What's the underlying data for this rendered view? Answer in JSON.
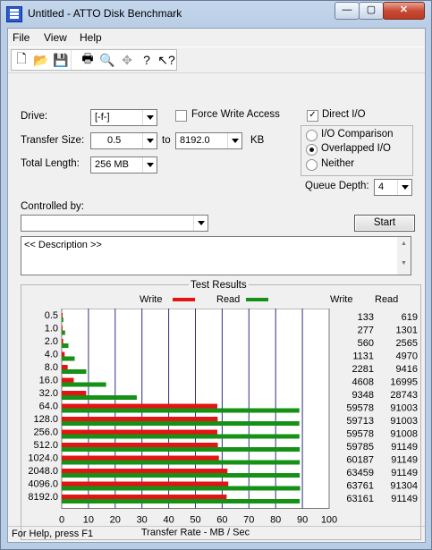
{
  "window": {
    "title": "Untitled - ATTO Disk Benchmark",
    "buttons": [
      "—",
      "▢",
      "✕"
    ]
  },
  "menu": [
    "File",
    "View",
    "Help"
  ],
  "toolbar": {
    "icons": [
      {
        "name": "new-document-icon",
        "glyph": "🗋"
      },
      {
        "name": "open-folder-icon",
        "glyph": "📂"
      },
      {
        "name": "save-icon",
        "glyph": "💾"
      },
      {
        "name": "print-icon",
        "glyph": "🖶"
      },
      {
        "name": "print-preview-icon",
        "glyph": "🔍"
      },
      {
        "name": "move-icon",
        "glyph": "✥"
      },
      {
        "name": "help-icon",
        "glyph": "?"
      },
      {
        "name": "context-help-icon",
        "glyph": "↖?"
      }
    ]
  },
  "form": {
    "drive_label": "Drive:",
    "drive_value": "[-f-]",
    "force_write_label": "Force Write Access",
    "direct_io_label": "Direct I/O",
    "transfer_size_label": "Transfer Size:",
    "transfer_from": "0.5",
    "to_label": "to",
    "transfer_to": "8192.0",
    "kb_label": "KB",
    "total_length_label": "Total Length:",
    "total_length": "256 MB",
    "io_comparison_label": "I/O Comparison",
    "overlapped_io_label": "Overlapped I/O",
    "neither_label": "Neither",
    "queue_depth_label": "Queue Depth:",
    "queue_depth_value": "4",
    "controlled_by_label": "Controlled by:",
    "controlled_by_value": "",
    "start_label": "Start",
    "description": "<< Description >>"
  },
  "results": {
    "title": "Test Results",
    "write_legend": "Write",
    "read_legend": "Read",
    "write_header": "Write",
    "read_header": "Read",
    "axis_title": "Transfer Rate - MB / Sec",
    "colors": {
      "write": "#e41414",
      "read": "#159116",
      "grid": "#2f2f83"
    }
  },
  "chart_data": {
    "type": "bar",
    "categories": [
      "0.5",
      "1.0",
      "2.0",
      "4.0",
      "8.0",
      "16.0",
      "32.0",
      "64.0",
      "128.0",
      "256.0",
      "512.0",
      "1024.0",
      "2048.0",
      "4096.0",
      "8192.0"
    ],
    "series": [
      {
        "name": "Write",
        "values": [
          0.13,
          0.27,
          0.55,
          1.1,
          2.23,
          4.5,
          9.13,
          58.18,
          58.31,
          58.18,
          58.38,
          58.77,
          61.97,
          62.27,
          61.68
        ]
      },
      {
        "name": "Read",
        "values": [
          0.6,
          1.27,
          2.5,
          4.85,
          9.2,
          16.6,
          28.07,
          88.87,
          88.87,
          88.88,
          89.01,
          89.01,
          89.01,
          89.16,
          89.01
        ]
      }
    ],
    "write_labels": [
      "133",
      "277",
      "560",
      "1131",
      "2281",
      "4608",
      "9348",
      "59578",
      "59713",
      "59578",
      "59785",
      "60187",
      "63459",
      "63761",
      "63161"
    ],
    "read_labels": [
      "619",
      "1301",
      "2565",
      "4970",
      "9416",
      "16995",
      "28743",
      "91003",
      "91003",
      "91008",
      "91149",
      "91149",
      "91149",
      "91304",
      "91149"
    ],
    "xlim": [
      0,
      100
    ],
    "x_ticks": [
      "0",
      "10",
      "20",
      "30",
      "40",
      "50",
      "60",
      "70",
      "80",
      "90",
      "100"
    ],
    "xlabel": "Transfer Rate - MB / Sec",
    "legend": "top",
    "grid": true
  },
  "statusbar": {
    "text": "For Help, press F1"
  }
}
